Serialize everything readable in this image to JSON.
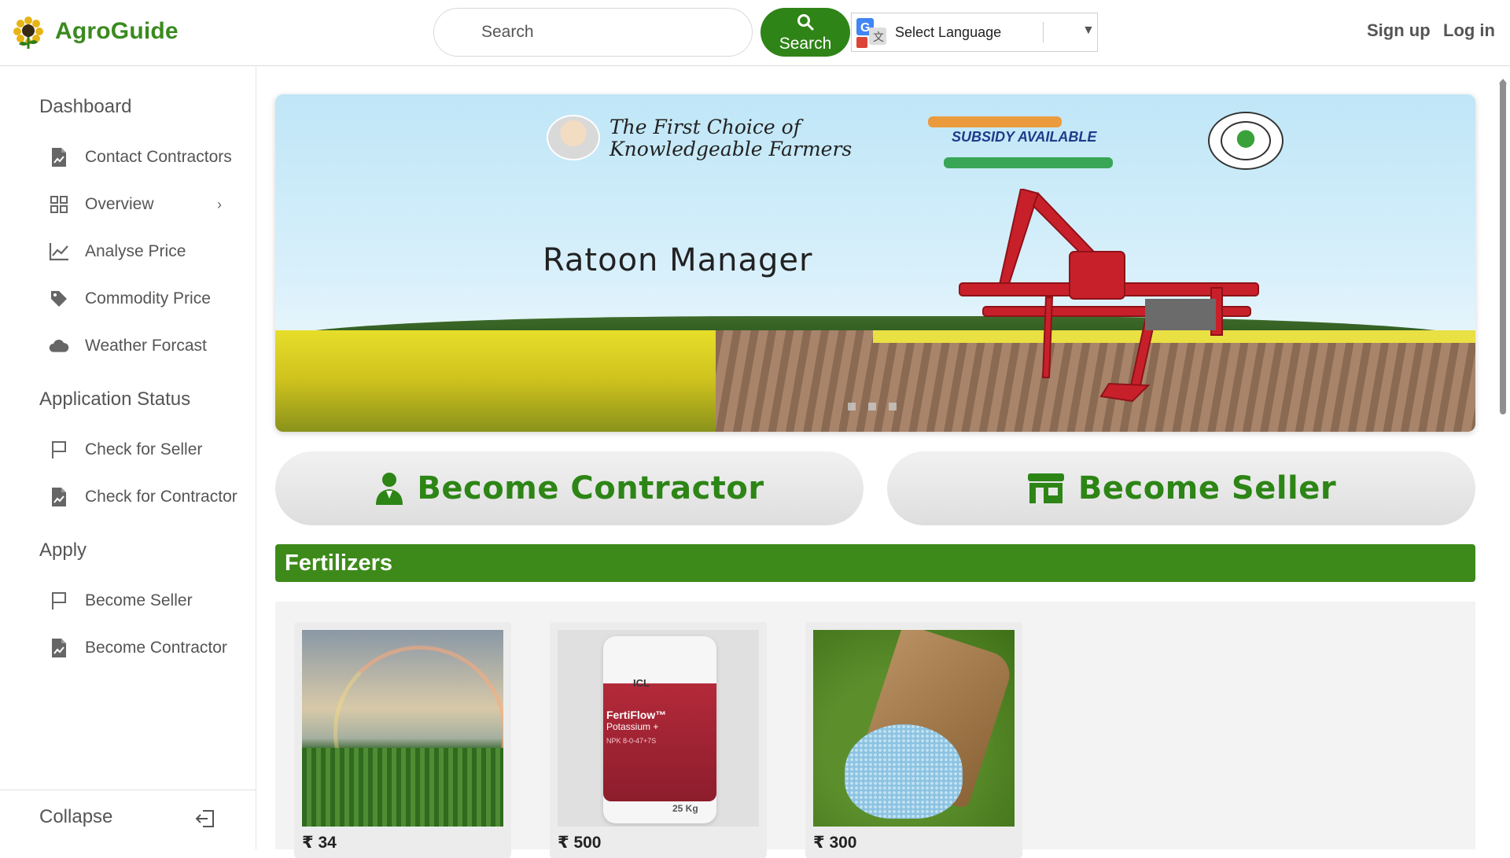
{
  "header": {
    "brand": "AgroGuide",
    "search_placeholder": "Search",
    "search_button": "Search",
    "language_label": "Select Language",
    "signup": "Sign up",
    "login": "Log in"
  },
  "sidebar": {
    "sections": [
      {
        "title": "Dashboard"
      },
      {
        "title": "Application Status"
      },
      {
        "title": "Apply"
      }
    ],
    "items": [
      {
        "label": "Contact Contractors",
        "icon": "document-icon"
      },
      {
        "label": "Overview",
        "icon": "grid-icon"
      },
      {
        "label": "Analyse Price",
        "icon": "chart-icon"
      },
      {
        "label": "Commodity Price",
        "icon": "tag-icon"
      },
      {
        "label": "Weather Forcast",
        "icon": "cloud-icon"
      },
      {
        "label": "Check for Seller",
        "icon": "flag-icon"
      },
      {
        "label": "Check for Contractor",
        "icon": "document-icon"
      },
      {
        "label": "Become Seller",
        "icon": "flag-icon"
      },
      {
        "label": "Become Contractor",
        "icon": "document-icon"
      }
    ],
    "collapse": "Collapse"
  },
  "banner": {
    "tagline_line1": "The First Choice of",
    "tagline_line2": "Knowledgeable Farmers",
    "subsidy": "SUBSIDY AVAILABLE",
    "product": "Ratoon Manager",
    "slides": 3
  },
  "cta": {
    "contractor": "Become Contractor",
    "seller": "Become Seller"
  },
  "section": {
    "title": "Fertilizers"
  },
  "products": [
    {
      "price": "₹ 34",
      "image": "rainbow-field"
    },
    {
      "price": "₹ 500",
      "image": "fertiflow-bag",
      "brand": "ICL",
      "name": "FertiFlow™",
      "name2": "Potassium +",
      "spec": "NPK 8-0-47+7S",
      "weight": "25 Kg"
    },
    {
      "price": "₹ 300",
      "image": "fertilizer-sack"
    }
  ],
  "colors": {
    "brand_green": "#2f8417",
    "section_green": "#3d8a1a",
    "text_gray": "#555555"
  }
}
